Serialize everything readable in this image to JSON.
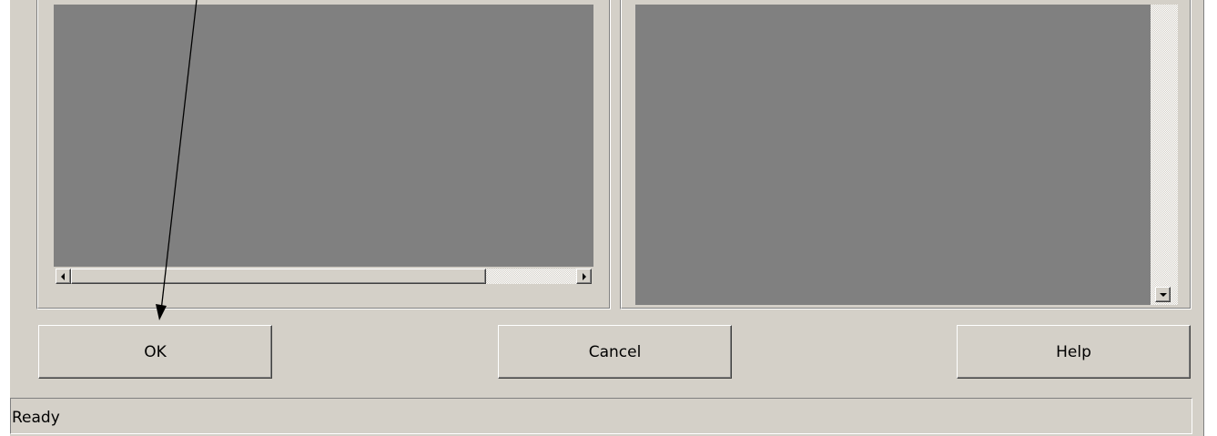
{
  "buttons": {
    "ok": "OK",
    "cancel": "Cancel",
    "help": "Help"
  },
  "status": {
    "text": "Ready"
  },
  "icons": {
    "scroll_left": "scroll-left-arrow-icon",
    "scroll_right": "scroll-right-arrow-icon",
    "scroll_down": "scroll-down-arrow-icon",
    "annotation": "annotation-arrow-pointing-to-ok"
  },
  "colors": {
    "dialog_face": "#d4d0c8",
    "canvas": "#808080",
    "annotation_arrow": "#000000"
  }
}
